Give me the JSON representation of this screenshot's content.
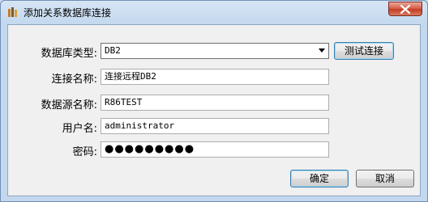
{
  "window": {
    "title": "添加关系数据库连接"
  },
  "form": {
    "db_type_label": "数据库类型:",
    "db_type_value": "DB2",
    "test_button": "测试连接",
    "connection_name_label": "连接名称:",
    "connection_name_value": "连接远程DB2",
    "datasource_label": "数据源名称:",
    "datasource_value": "R86TEST",
    "username_label": "用户名:",
    "username_value": "administrator",
    "password_label": "密码:",
    "password_value": "●●●●●●●●●"
  },
  "actions": {
    "ok": "确定",
    "cancel": "取消"
  }
}
